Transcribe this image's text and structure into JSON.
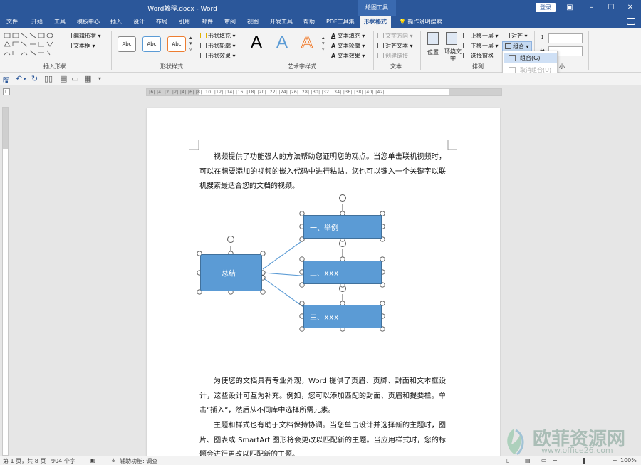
{
  "window": {
    "title": "Word教程.docx  -  Word",
    "context_tab": "绘图工具",
    "login_label": "登录"
  },
  "tabs": [
    "文件",
    "开始",
    "工具",
    "模板中心",
    "插入",
    "设计",
    "布局",
    "引用",
    "邮件",
    "审阅",
    "视图",
    "开发工具",
    "帮助",
    "PDF工具集",
    "形状格式"
  ],
  "active_tab": "形状格式",
  "tell_me": "操作说明搜索",
  "ribbon": {
    "insert_shapes": {
      "label": "插入形状",
      "edit_shape": "编辑形状",
      "text_box": "文本框"
    },
    "shape_styles": {
      "label": "形状样式",
      "preview": "Abc",
      "fill": "形状填充",
      "outline": "形状轮廓",
      "effect": "形状效果"
    },
    "wordart_styles": {
      "label": "艺术字样式",
      "glyph": "A",
      "text_fill": "文本填充",
      "text_outline": "文本轮廓",
      "text_effect": "文本效果"
    },
    "text": {
      "label": "文本",
      "direction": "文字方向",
      "align": "对齐文本",
      "link": "创建链接"
    },
    "arrange": {
      "label": "排列",
      "position": "位置",
      "wrap": "环绕文字",
      "bring_forward": "上移一层",
      "send_backward": "下移一层",
      "selection_pane": "选择窗格",
      "align": "对齐",
      "group": "组合"
    },
    "size": {
      "label": "小"
    }
  },
  "group_menu": {
    "group": "组合(G)",
    "ungroup": "取消组合(U)"
  },
  "ruler": {
    "marks": "|6|  |4|  |2|     |2|  |4|  |6|  |8|  |10|  |12|  |14|  |16|  |18|  |20|  |22|  |24|  |26|  |28|  |30|  |32|  |34|  |36|  |38|  |40|  |42|"
  },
  "document": {
    "para1": "视频提供了功能强大的方法帮助您证明您的观点。当您单击联机视频时，可以在想要添加的视频的嵌入代码中进行粘贴。您也可以键入一个关键字以联机搜索最适合您的文档的视频。",
    "para2": "为使您的文档具有专业外观，Word 提供了页眉、页脚、封面和文本框设计，这些设计可互为补充。例如，您可以添加匹配的封面、页眉和提要栏。单击“插入”，然后从不同库中选择所需元素。",
    "para3": "主题和样式也有助于文档保持协调。当您单击设计并选择新的主题时，图片、图表或 SmartArt 图形将会更改以匹配新的主题。当应用样式时，您的标题会进行更改以匹配新的主题。"
  },
  "diagram": {
    "summary": "总结",
    "box1": "一、举例",
    "box2": "二、XXX",
    "box3": "三、XXX",
    "fill_color": "#5b9bd5",
    "line_color": "#5b9bd5"
  },
  "statusbar": {
    "page": "第 1 页，共 8 页",
    "words": "904 个字",
    "accessibility": "辅助功能: 调查",
    "zoom": "100%"
  },
  "watermark": {
    "text": "欧菲资源网",
    "url": "www.office26.com"
  }
}
